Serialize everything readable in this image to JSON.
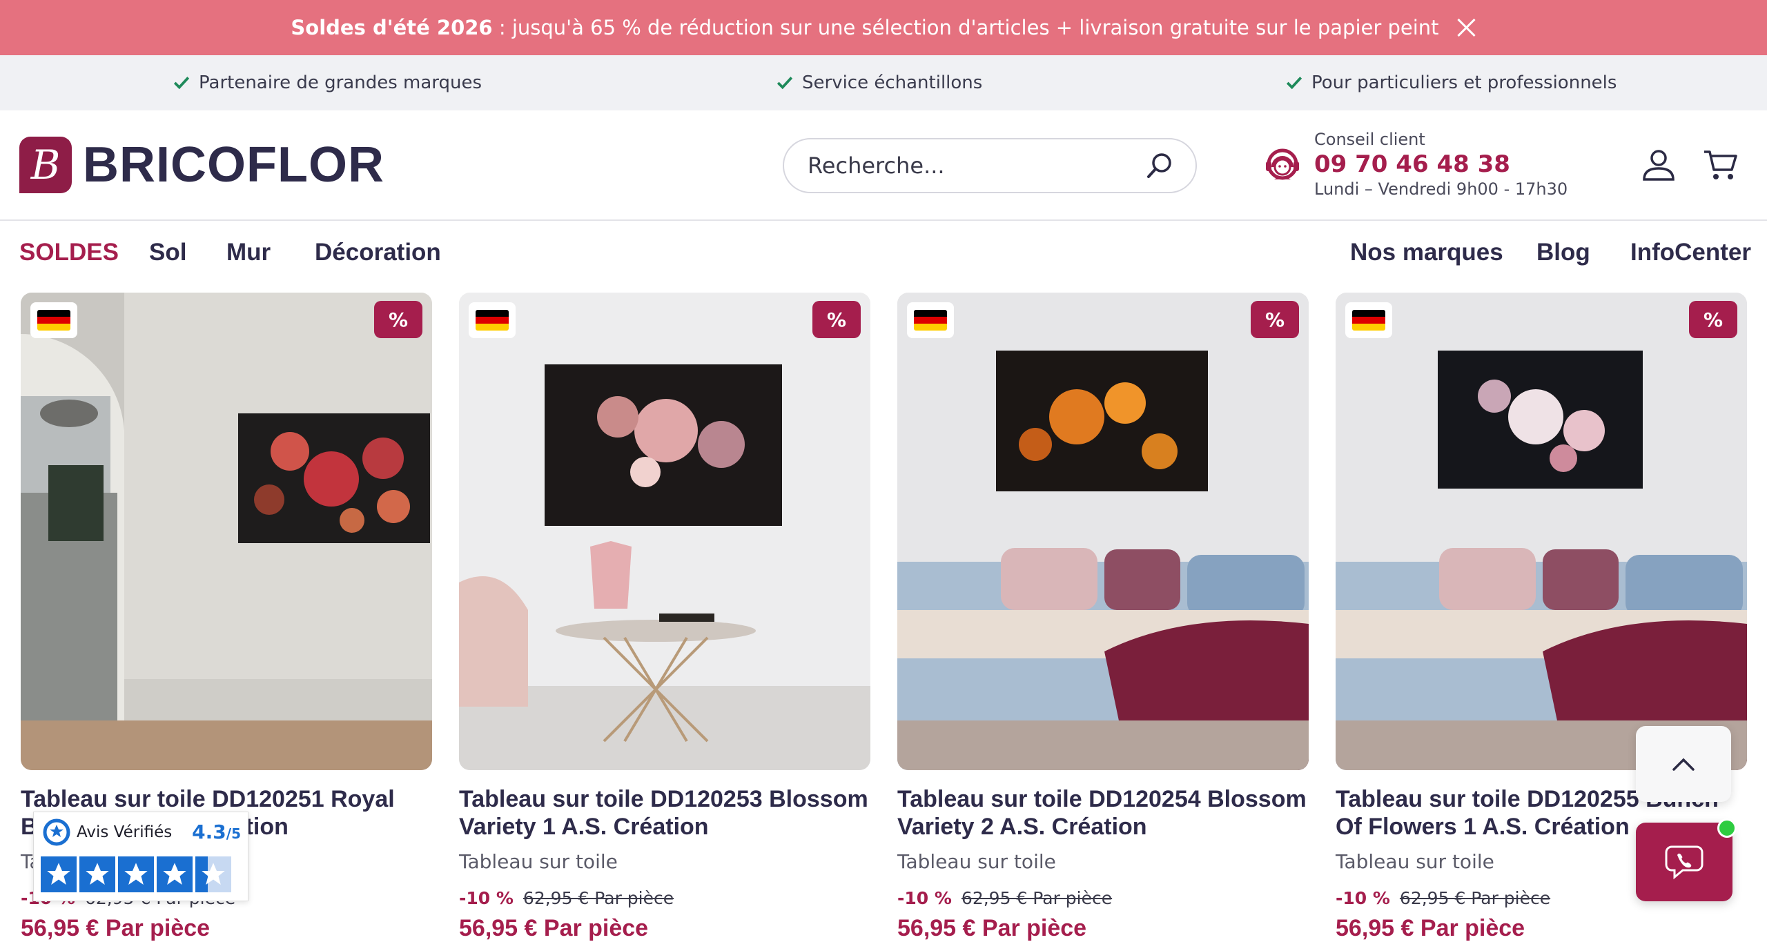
{
  "promo": {
    "bold": "Soldes d'été 2026",
    "text": " : jusqu'à 65 % de réduction sur une sélection d'articles + livraison gratuite sur le papier peint"
  },
  "usp": [
    "Partenaire de grandes marques",
    "Service échantillons",
    "Pour particuliers et professionnels"
  ],
  "logo": {
    "text": "BRICOFLOR",
    "mark": "B"
  },
  "search": {
    "placeholder": "Recherche..."
  },
  "support": {
    "label": "Conseil client",
    "phone": "09 70 46 48 38",
    "hours": "Lundi – Vendredi 9h00 - 17h30"
  },
  "nav": {
    "left": [
      "SOLDES",
      "Sol",
      "Mur",
      "Décoration"
    ],
    "right": [
      "Nos marques",
      "Blog",
      "InfoCenter"
    ]
  },
  "products": [
    {
      "name": "Tableau sur toile DD120251 Royal Bouquet 1 A.S. Création",
      "category": "Tableau sur toile",
      "discount": "-10 %",
      "old_price": "62,95 € Par pièce",
      "price": "56,95 € Par pièce",
      "badge": "%"
    },
    {
      "name": "Tableau sur toile DD120253 Blossom Variety 1 A.S. Création",
      "category": "Tableau sur toile",
      "discount": "-10 %",
      "old_price": "62,95 € Par pièce",
      "price": "56,95 € Par pièce",
      "badge": "%"
    },
    {
      "name": "Tableau sur toile DD120254 Blossom Variety 2 A.S. Création",
      "category": "Tableau sur toile",
      "discount": "-10 %",
      "old_price": "62,95 € Par pièce",
      "price": "56,95 € Par pièce",
      "badge": "%"
    },
    {
      "name": "Tableau sur toile DD120255 Bunch Of Flowers 1 A.S. Création",
      "category": "Tableau sur toile",
      "discount": "-10 %",
      "old_price": "62,95 € Par pièce",
      "price": "56,95 € Par pièce",
      "badge": "%"
    }
  ],
  "avis": {
    "brand": "Avis Vérifiés",
    "score": "4.3",
    "scale": "/5"
  },
  "colors": {
    "accent": "#a51e4d",
    "promo": "#e5717f",
    "navy": "#2e2b4a",
    "check": "#1e8a5a"
  }
}
